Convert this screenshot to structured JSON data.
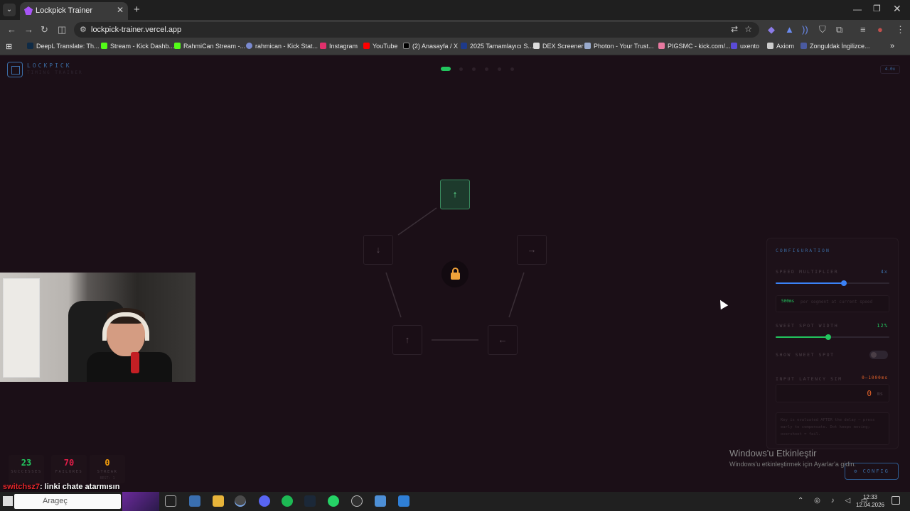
{
  "browser": {
    "tab_title": "Lockpick Trainer",
    "url": "lockpick-trainer.vercel.app",
    "bookmarks": [
      "DeepL Translate: Th...",
      "Stream - Kick Dashb...",
      "RahmiCan Stream -...",
      "rahmican - Kick Stat...",
      "Instagram",
      "YouTube",
      "(2) Anasayfa / X",
      "2025 Tamamlayıcı S...",
      "DEX Screener",
      "Photon - Your Trust...",
      "PIGSMC - kick.com/...",
      "uxento",
      "Axiom",
      "Zonguldak İngilizce..."
    ]
  },
  "app": {
    "logo": "LOCKPICK",
    "logo_sub": "TIMING TRAINER",
    "speed_badge": "4.0x",
    "progress": {
      "active_index": 0,
      "total": 6
    },
    "keys": [
      {
        "glyph": "↑",
        "active": true
      },
      {
        "glyph": "→",
        "active": false
      },
      {
        "glyph": "←",
        "active": false
      },
      {
        "glyph": "↑",
        "active": false
      },
      {
        "glyph": "↓",
        "active": false
      }
    ],
    "config": {
      "title": "CONFIGURATION",
      "speed_label": "SPEED MULTIPLIER",
      "speed_value": "4x",
      "speed_fraction": 0.6,
      "speed_hint_value": "500ms",
      "speed_hint_text": "per segment at current speed",
      "sweet_label": "SWEET SPOT WIDTH",
      "sweet_value": "12%",
      "sweet_fraction": 0.46,
      "show_sweet_label": "SHOW SWEET SPOT",
      "latency_label": "INPUT LATENCY SIM",
      "latency_range": "0–1000ms",
      "latency_value": "0",
      "latency_unit": "ms",
      "latency_note": "Key is evaluated AFTER the delay — press early to compensate. Dot keeps moving; overshoot = fail."
    },
    "config_button": "CONFIG",
    "stats": [
      {
        "value": "23",
        "label": "SUCCESSES",
        "sub": "",
        "color": "#22c55e"
      },
      {
        "value": "70",
        "label": "FAILURES",
        "sub": "",
        "color": "#e11d48"
      },
      {
        "value": "0",
        "label": "STREAK",
        "sub": "BEST: 1",
        "color": "#f59e0b"
      }
    ],
    "colors": {
      "accent_blue": "#3a6aa0",
      "success_green": "#22c55e",
      "lock_orange": "#f0a33a",
      "latency_orange": "#e5632a"
    }
  },
  "os": {
    "watermark_title": "Windows'u Etkinleştir",
    "watermark_sub": "Windows'u etkinleştirmek için Ayarlar'a gidin.",
    "search_text": "Arageç",
    "time": "12:33",
    "date": "12.04.2026"
  },
  "stream": {
    "chat_user": "switchsz7",
    "chat_message": ": linki chate atarmısın"
  }
}
